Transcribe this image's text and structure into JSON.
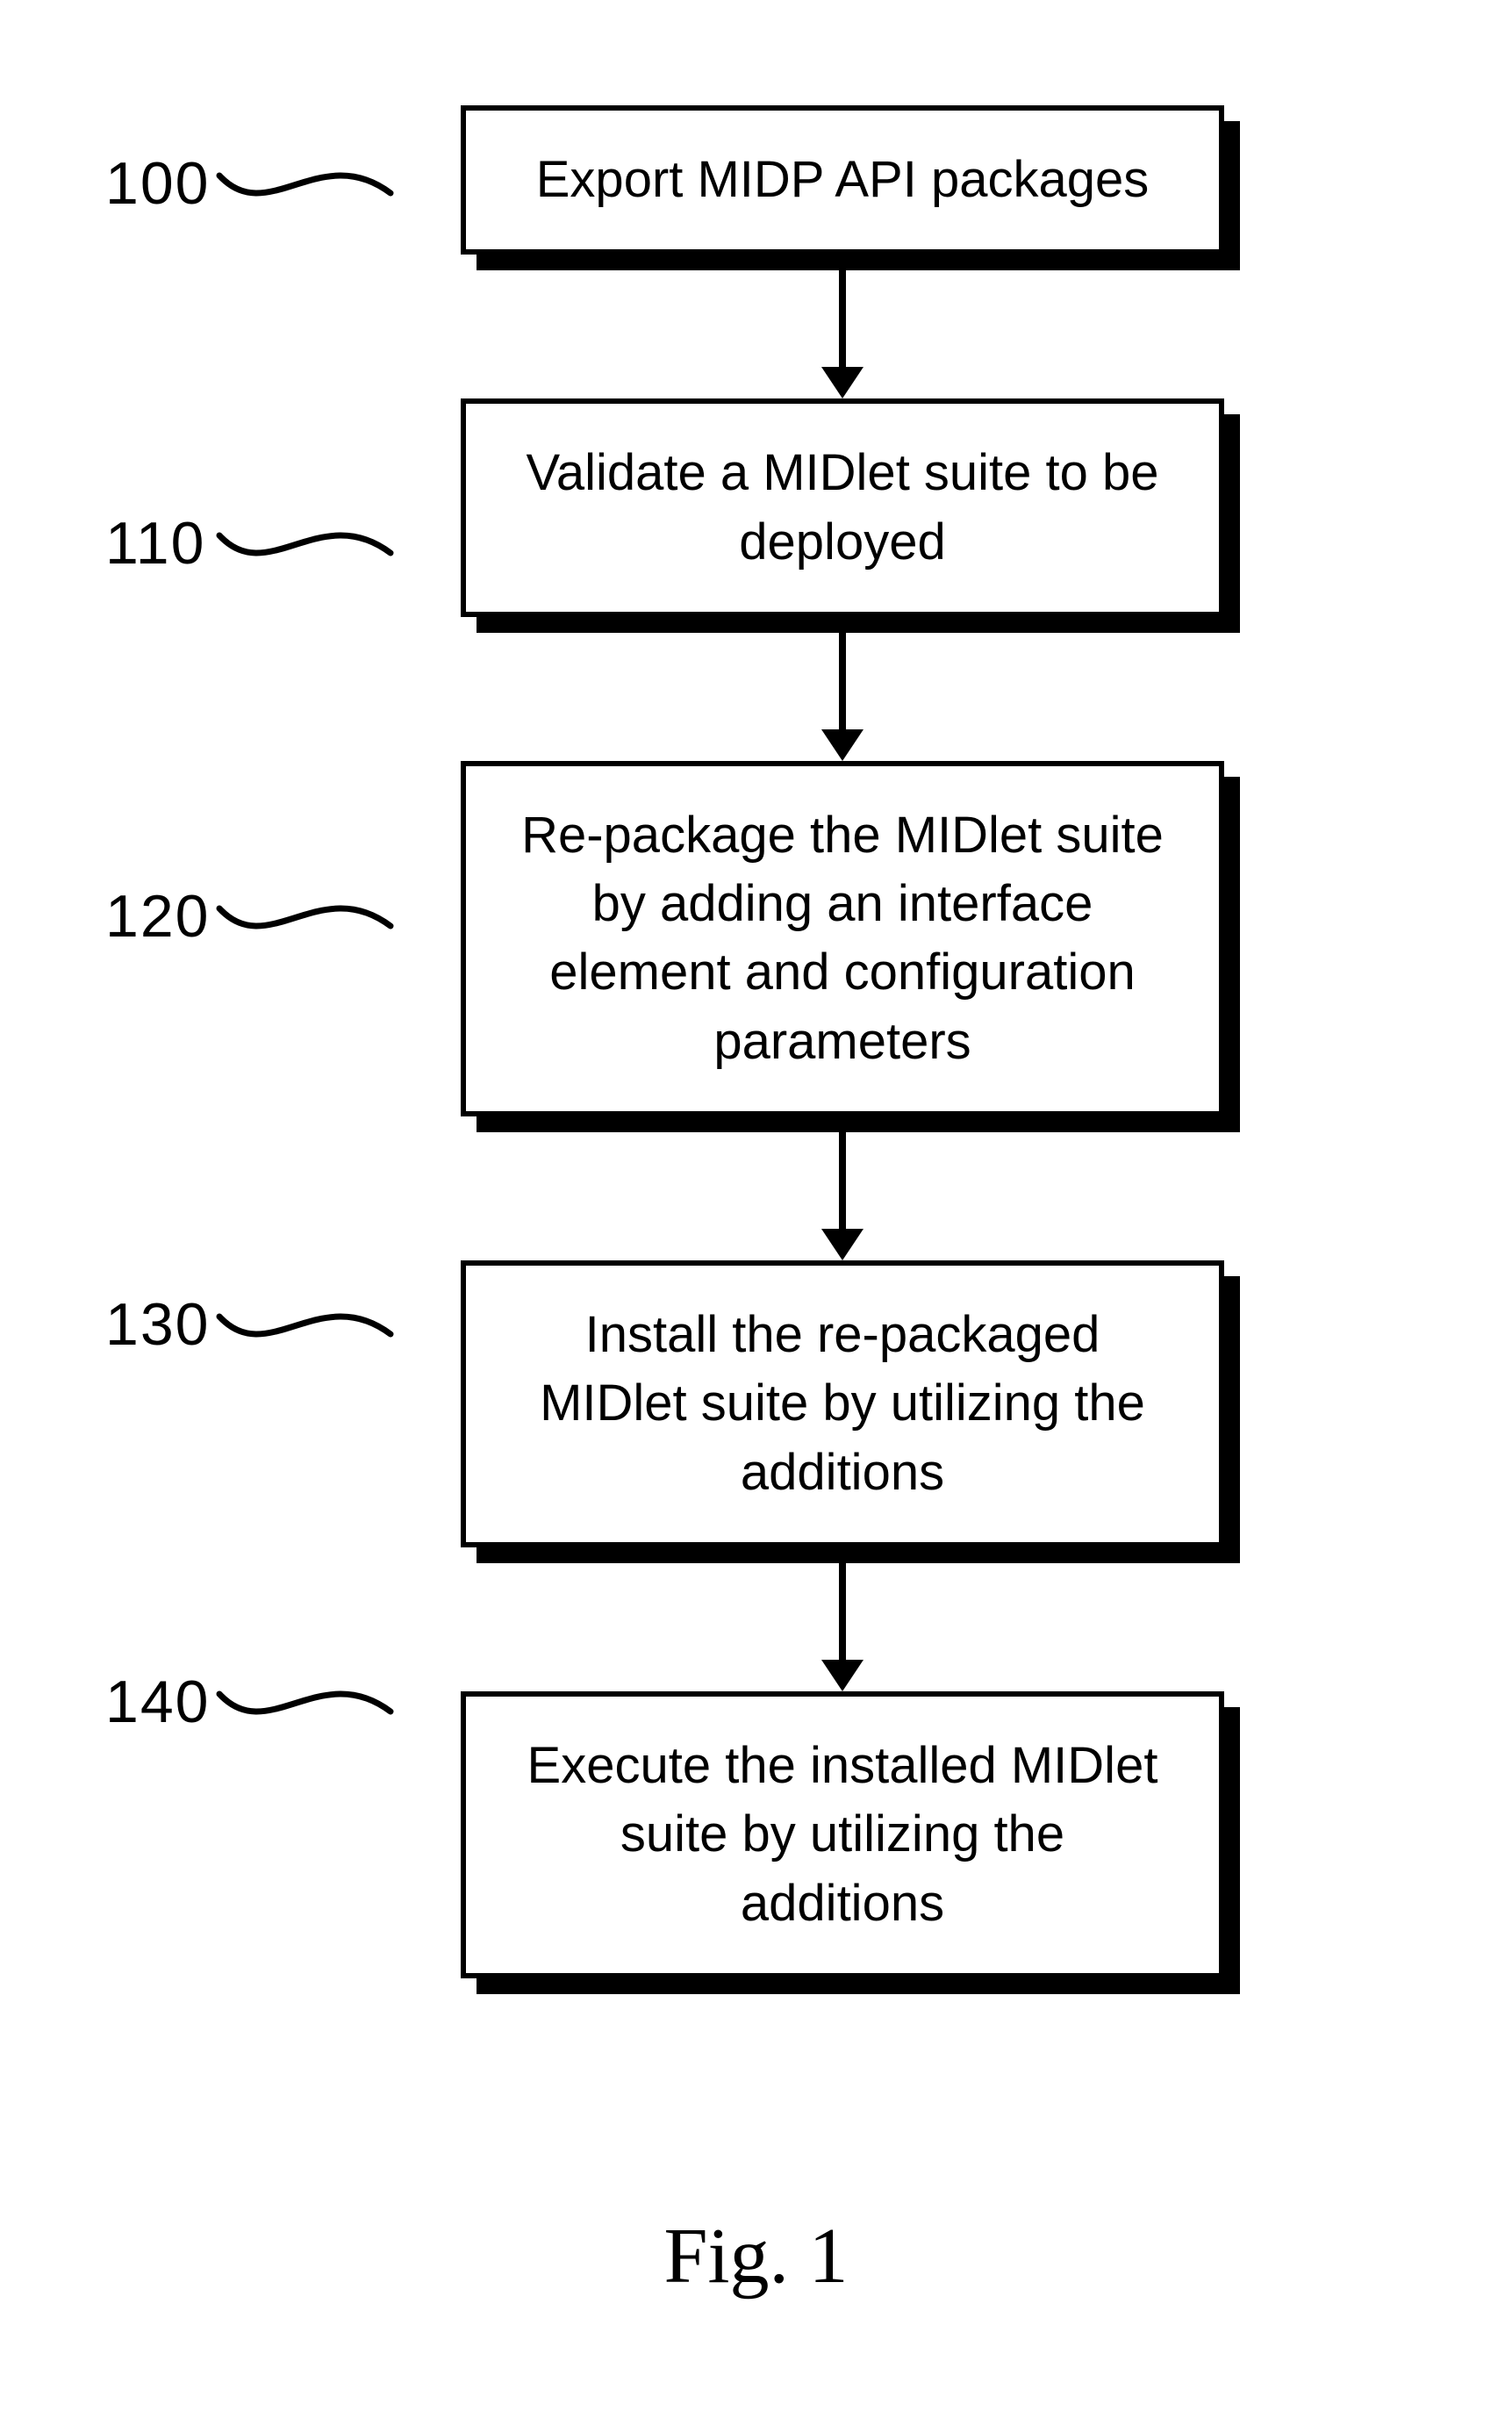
{
  "caption": "Fig. 1",
  "steps": [
    {
      "num": "100",
      "text": "Export MIDP API packages"
    },
    {
      "num": "110",
      "text": "Validate a MIDlet suite to be deployed"
    },
    {
      "num": "120",
      "text": "Re-package the MIDlet suite by adding an interface element and configuration parameters"
    },
    {
      "num": "130",
      "text": "Install the re-packaged MIDlet suite by utilizing the additions"
    },
    {
      "num": "140",
      "text": "Execute the installed MIDlet suite by utilizing the additions"
    }
  ]
}
